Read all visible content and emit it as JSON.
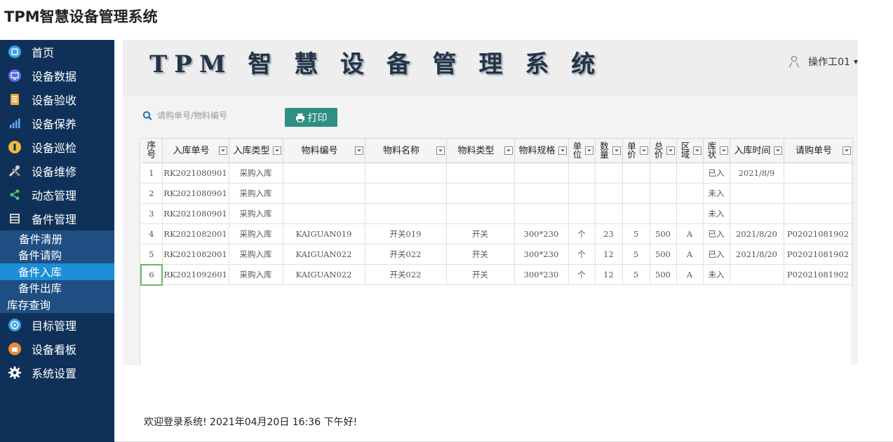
{
  "app_title": "TPM智慧设备管理系统",
  "banner_title": "TPM 智 慧 设 备 管 理 系 统",
  "user": {
    "name": "操作工01",
    "dropdown": "▾"
  },
  "sidebar": {
    "items": [
      {
        "label": "首页",
        "icon": "home-icon",
        "color": "#3aa0e8"
      },
      {
        "label": "设备数据",
        "icon": "monitor-icon",
        "color": "#5b6ee0"
      },
      {
        "label": "设备验收",
        "icon": "clipboard-icon",
        "color": "#e8a93a"
      },
      {
        "label": "设备保养",
        "icon": "signal-icon",
        "color": "#6aa6e8"
      },
      {
        "label": "设备巡检",
        "icon": "inspection-icon",
        "color": "#f0b93a"
      },
      {
        "label": "设备维修",
        "icon": "tools-icon",
        "color": "#d0d0d0"
      },
      {
        "label": "动态管理",
        "icon": "share-icon",
        "color": "#4fc76a"
      },
      {
        "label": "备件管理",
        "icon": "spare-parts-icon",
        "color": "#cccccc"
      }
    ],
    "submenu": [
      {
        "label": "备件清册"
      },
      {
        "label": "备件请购"
      },
      {
        "label": "备件入库",
        "active": true
      },
      {
        "label": "备件出库"
      },
      {
        "label": "库存查询"
      }
    ],
    "items_after": [
      {
        "label": "目标管理",
        "icon": "target-icon",
        "color": "#3aa0e8"
      },
      {
        "label": "设备看板",
        "icon": "dashboard-icon",
        "color": "#f08a3a"
      },
      {
        "label": "系统设置",
        "icon": "gear-icon",
        "color": "#ffffff"
      }
    ]
  },
  "toolbar": {
    "search_placeholder": "请购单号/物料编号",
    "print_label": "打印"
  },
  "table": {
    "columns": [
      "序号",
      "入库单号",
      "入库类型",
      "物料编号",
      "物料名称",
      "物料类型",
      "物料规格",
      "单\n位",
      "数\n量",
      "单\n价",
      "总\n价",
      "区\n域",
      "库\n状",
      "入库时间",
      "请购单号"
    ],
    "rows": [
      [
        "1",
        "RK2021080901",
        "采购入库",
        "",
        "",
        "",
        "",
        "",
        "",
        "",
        "",
        "",
        "已入",
        "2021/8/9",
        ""
      ],
      [
        "2",
        "RK2021080901",
        "采购入库",
        "",
        "",
        "",
        "",
        "",
        "",
        "",
        "",
        "",
        "未入",
        "",
        ""
      ],
      [
        "3",
        "RK2021080901",
        "采购入库",
        "",
        "",
        "",
        "",
        "",
        "",
        "",
        "",
        "",
        "未入",
        "",
        ""
      ],
      [
        "4",
        "RK2021082001",
        "采购入库",
        "KAIGUAN019",
        "开关019",
        "开关",
        "300*230",
        "个",
        "23",
        "5",
        "500",
        "A",
        "已入",
        "2021/8/20",
        "P02021081902"
      ],
      [
        "5",
        "RK2021082001",
        "采购入库",
        "KAIGUAN022",
        "开关022",
        "开关",
        "300*230",
        "个",
        "12",
        "5",
        "500",
        "A",
        "已入",
        "2021/8/20",
        "P02021081902"
      ],
      [
        "6",
        "RK2021092601",
        "采购入库",
        "KAIGUAN022",
        "开关022",
        "开关",
        "300*230",
        "个",
        "12",
        "5",
        "500",
        "A",
        "未入",
        "",
        "P02021081902"
      ]
    ],
    "selected_row": 6
  },
  "footer": {
    "welcome": "欢迎登录系统!   2021年04月20日 16:36 下午好!"
  }
}
